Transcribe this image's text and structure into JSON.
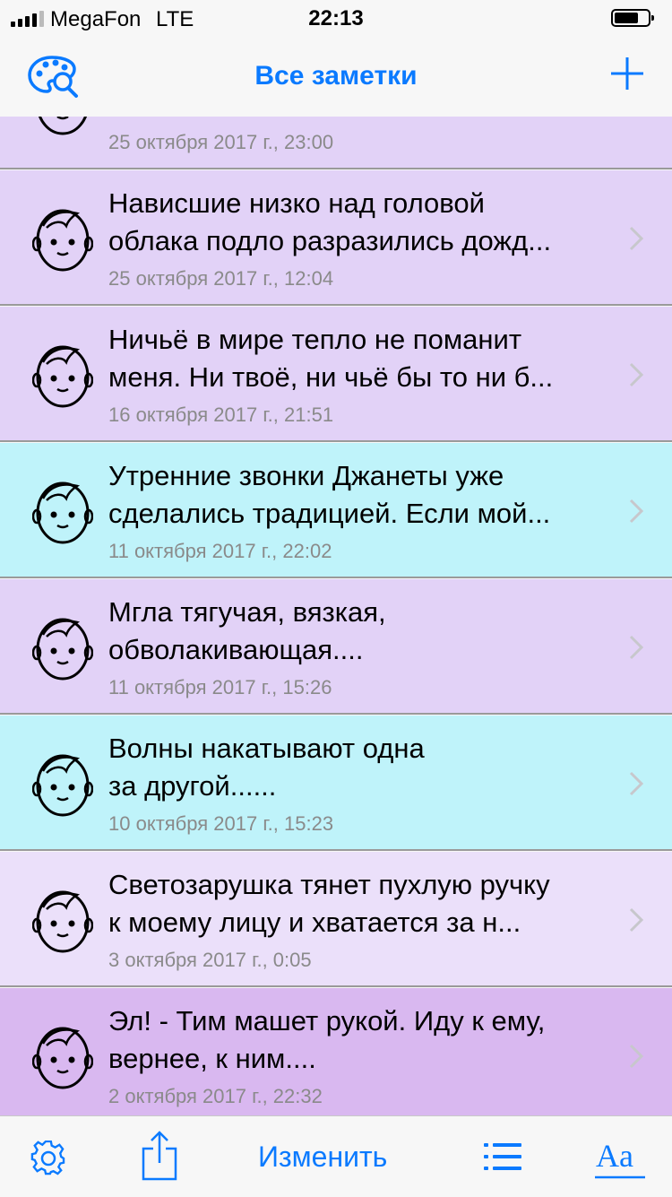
{
  "status_bar": {
    "carrier": "MegaFon",
    "network": "LTE",
    "time": "22:13"
  },
  "nav": {
    "title": "Все заметки",
    "left_icon": "palette-search-icon",
    "right_icon": "plus-icon"
  },
  "notes": [
    {
      "lines": [
        "",
        ""
      ],
      "date": "25 октября 2017 г., 23:00",
      "color": "#e2d2f7",
      "partial": true
    },
    {
      "lines": [
        "Нависшие низко над головой",
        "облака подло разразились дожд..."
      ],
      "date": "25 октября 2017 г., 12:04",
      "color": "#e2d2f7"
    },
    {
      "lines": [
        "Ничьё в мире тепло не поманит",
        "меня. Ни твоё, ни чьё бы то ни б..."
      ],
      "date": "16 октября 2017 г., 21:51",
      "color": "#e2d2f7"
    },
    {
      "lines": [
        "Утренние звонки Джанеты уже",
        "сделались традицией. Если мой..."
      ],
      "date": "11 октября 2017 г., 22:02",
      "color": "#bff3fa"
    },
    {
      "lines": [
        "Мгла тягучая, вязкая,",
        "обволакивающая...."
      ],
      "date": "11 октября 2017 г., 15:26",
      "color": "#e2d2f7"
    },
    {
      "lines": [
        "Волны накатывают одна",
        "за другой......"
      ],
      "date": "10 октября 2017 г., 15:23",
      "color": "#bff3fa"
    },
    {
      "lines": [
        "Светозарушка тянет пухлую ручку",
        "к моему лицу и хватается за н..."
      ],
      "date": "3 октября 2017 г., 0:05",
      "color": "#ebe0fa"
    },
    {
      "lines": [
        "Эл! - Тим машет рукой. Иду к ему,",
        "вернее, к ним...."
      ],
      "date": "2 октября 2017 г., 22:32",
      "color": "#d9b8f0"
    }
  ],
  "toolbar": {
    "edit_label": "Изменить",
    "gear_icon": "gear-icon",
    "share_icon": "share-icon",
    "list_icon": "list-icon",
    "font_icon": "font-icon",
    "font_label": "Aa"
  },
  "colors": {
    "accent": "#0a7aff",
    "lilac": "#e2d2f7",
    "cyan": "#bff3fa",
    "violet": "#d9b8f0"
  }
}
